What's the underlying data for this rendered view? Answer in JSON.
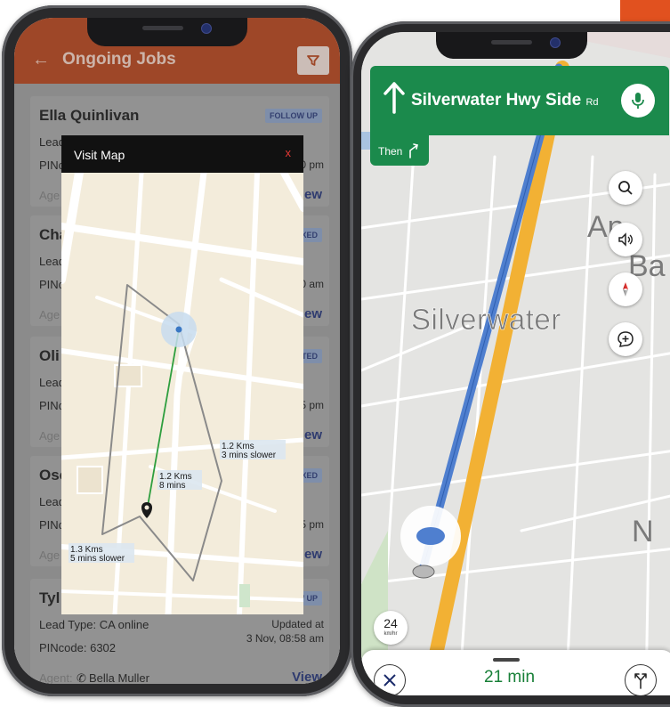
{
  "left_app": {
    "header": {
      "title": "Ongoing Jobs"
    },
    "jobs": [
      {
        "name": "Ella Quinlivan",
        "tag": "FOLLOW UP",
        "line1": "Lead",
        "line2": "PINc",
        "time": "0 pm",
        "agent": "Age",
        "view": "View"
      },
      {
        "name": "Cha",
        "tag": "IXED",
        "line1": "Lead",
        "line2": "PINc",
        "time": "0 am",
        "agent": "Age",
        "view": "View"
      },
      {
        "name": "Oli",
        "tag": "CTED",
        "line1": "Lead",
        "line2": "PINc",
        "time": "5 pm",
        "agent": "Age",
        "view": "View"
      },
      {
        "name": "Osc",
        "tag": "IXED",
        "line1": "Lead",
        "line2": "PINc",
        "time": "5 pm",
        "agent": "Age",
        "view": "View"
      },
      {
        "name": "Tyl",
        "tag": "W UP",
        "line1": "Lead Type: CA online",
        "line2": "PINcode: 6302",
        "updated_label": "Updated at",
        "updated_time": "3 Nov, 08:58 am",
        "agent_label": "Agent:",
        "agent_name": "Bella Muller",
        "view": "View"
      }
    ],
    "map_modal": {
      "title": "Visit Map",
      "close": "x",
      "labels": [
        {
          "line1": "1.2 Kms",
          "line2": "3 mins slower"
        },
        {
          "line1": "1.2 Kms",
          "line2": "8 mins"
        },
        {
          "line1": "1.3 Kms",
          "line2": "5 mins slower"
        }
      ]
    },
    "colors": {
      "header": "#b8441b",
      "route_green": "#2e9e3e",
      "route_gray": "#8a8a8a"
    }
  },
  "right_app": {
    "banner": {
      "street": "Silverwater Hwy Side",
      "suffix": "Rd",
      "then": "Then"
    },
    "map_labels": {
      "main": "Silverwater",
      "edge1": "An",
      "edge2": "Ba",
      "edge3": "N"
    },
    "speed": {
      "value": "24",
      "unit": "km/hr"
    },
    "eta": "21 min",
    "icons": [
      "arrow-up-icon",
      "mic-icon",
      "search-icon",
      "volume-icon",
      "compass-icon",
      "add-report-icon",
      "close-icon",
      "alt-routes-icon"
    ],
    "colors": {
      "banner": "#1b8a4c",
      "route_blue": "#4f7fcf",
      "eta_green": "#188038"
    }
  }
}
